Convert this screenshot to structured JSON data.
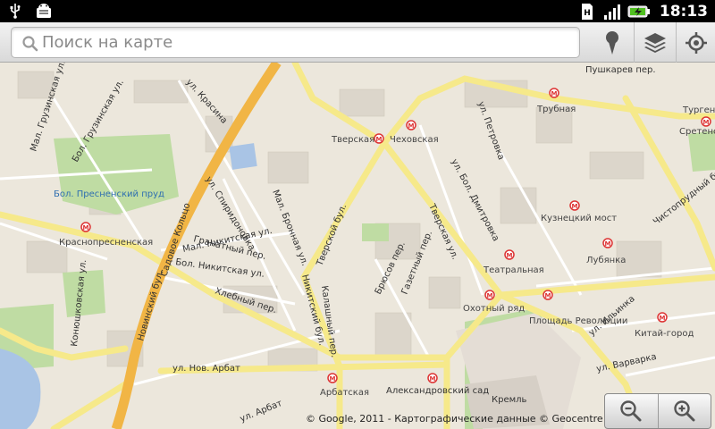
{
  "status_bar": {
    "time": "18:13",
    "icons": [
      "usb-icon",
      "android-debug-icon",
      "sd-card-icon",
      "signal-icon",
      "battery-charging-icon"
    ]
  },
  "search": {
    "placeholder": "Поиск на карте"
  },
  "toolbar": {
    "buttons": [
      "place-marker-icon",
      "layers-icon",
      "my-location-icon"
    ]
  },
  "map": {
    "streets": [
      "Садовое Кольцо",
      "ул. Красина",
      "Мал. Грузинская ул.",
      "Бол. Грузинская ул.",
      "ул. Спиридоновка",
      "Мал. Бронная ул.",
      "Гранатный пер.",
      "Мал. Никитская ул.",
      "Бол. Никитская ул.",
      "Хлебный пер.",
      "Новинский бул.",
      "Конюшковская ул.",
      "ул. Нов. Арбат",
      "Никитский бул.",
      "Тверской бул.",
      "Калашный пер.",
      "Брюсов пер.",
      "Газетный пер.",
      "Тверская ул.",
      "ул. Бол. Дмитровка",
      "ул. Петровка",
      "Пушкарев пер.",
      "Чистопрудный бул.",
      "ул. Ильинка",
      "ул. Варварка",
      "Александровский сад",
      "Кремль",
      "Площадь Революции",
      "ул. Арбат"
    ],
    "places": [
      "Бол. Пресненский пруд",
      "Сретенский бульвар"
    ],
    "metro": [
      "Краснопресненская",
      "Тверская",
      "Чеховская",
      "Трубная",
      "Тургенев",
      "Кузнецкий мост",
      "Лубянка",
      "Театральная",
      "Охотный ряд",
      "Китай-город",
      "Арбатская"
    ]
  },
  "copyright": "© Google, 2011 - Картографические данные © Geocentre Consulting",
  "zoom": {
    "out": "zoom-out-icon",
    "in": "zoom-in-icon"
  }
}
